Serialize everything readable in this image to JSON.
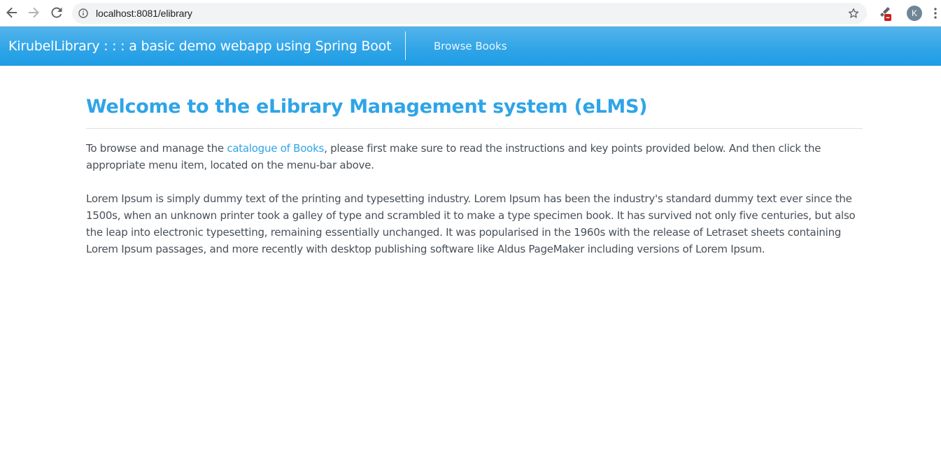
{
  "browser": {
    "url": "localhost:8081/elibrary",
    "avatar_initial": "K"
  },
  "navbar": {
    "brand": "KirubelLibrary : : : a basic demo webapp using Spring Boot",
    "links": [
      {
        "label": "Browse Books"
      }
    ]
  },
  "main": {
    "title": "Welcome to the eLibrary Management system (eLMS)",
    "intro_before": "To browse and manage the ",
    "intro_link": "catalogue of Books",
    "intro_after": ", please first make sure to read the instructions and key points provided below. And then click the appropriate menu item, located on the menu-bar above.",
    "lorem": "Lorem Ipsum is simply dummy text of the printing and typesetting industry. Lorem Ipsum has been the industry's standard dummy text ever since the 1500s, when an unknown printer took a galley of type and scrambled it to make a type specimen book. It has survived not only five centuries, but also the leap into electronic typesetting, remaining essentially unchanged. It was popularised in the 1960s with the release of Letraset sheets containing Lorem Ipsum passages, and more recently with desktop publishing software like Aldus PageMaker including versions of Lorem Ipsum."
  },
  "colors": {
    "accent": "#2fa4e7",
    "text": "#495057",
    "navbar_top": "#54b4eb",
    "navbar_bottom": "#1d9ce5"
  },
  "icons": {
    "back": "arrow-left-icon",
    "forward": "arrow-right-icon",
    "reload": "reload-icon",
    "site_info": "info-icon",
    "bookmark": "star-icon",
    "extension": "paint-brush-icon",
    "menu": "kebab-menu-icon"
  }
}
